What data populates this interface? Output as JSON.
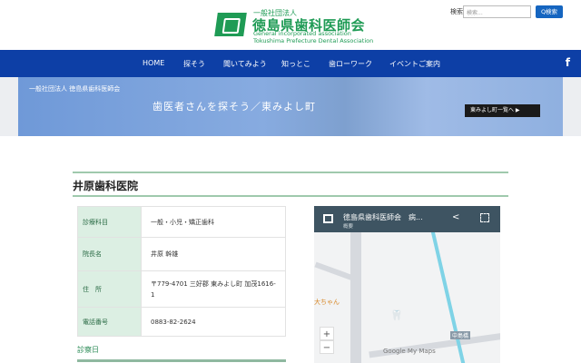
{
  "header": {
    "org_type": "一般社団法人",
    "org_name": "徳島県歯科医師会",
    "org_en_1": "General incorporated association",
    "org_en_2": "Tokushima Prefecture Dental Association",
    "search_label": "検索",
    "search_placeholder": "検索...",
    "search_button": "Q検索"
  },
  "nav": {
    "items": [
      "HOME",
      "探そう",
      "聞いてみよう",
      "知っとこ",
      "歯ローワーク",
      "イベントご案内"
    ],
    "facebook": "f"
  },
  "banner": {
    "logo_text": "一般社団法人 徳島県歯科医師会",
    "title": "歯医者さんを探そう／東みよし町",
    "button": "東みよし町一覧へ ▶"
  },
  "clinic": {
    "name": "井原歯科医院",
    "rows": [
      {
        "label": "診療科目",
        "value": "一般・小児・矯正歯科"
      },
      {
        "label": "院長名",
        "value": "井原 幹雄"
      },
      {
        "label": "住　所",
        "value": "〒779-4701 三好郡 東みよし町 加茂1616-1"
      },
      {
        "label": "電話番号",
        "value": "0883-82-2624"
      }
    ],
    "section": "診察日"
  },
  "map": {
    "title": "徳島県歯科医師会　病...",
    "subtitle": "概要",
    "place_label": "大ちゃん",
    "road_label": "中島橋",
    "brand": "Google My Maps",
    "zoom_in": "+",
    "zoom_out": "−"
  }
}
